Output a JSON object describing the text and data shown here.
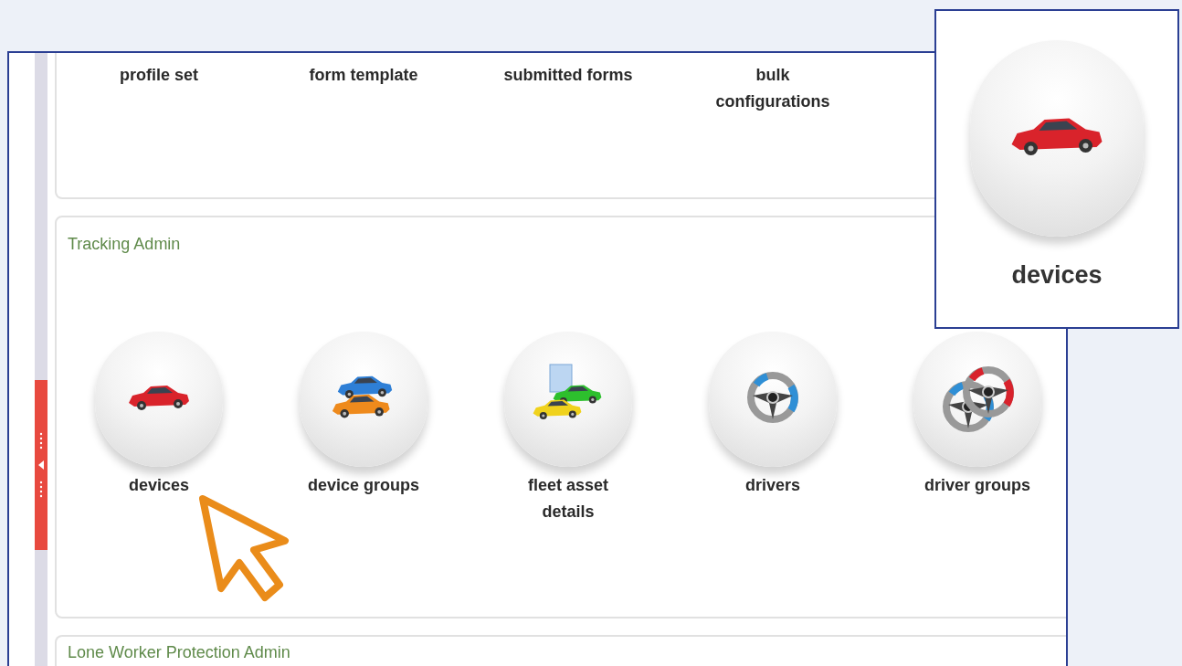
{
  "sections": [
    {
      "items": [
        {
          "label": "profile set"
        },
        {
          "label": "form template"
        },
        {
          "label": "submitted forms"
        },
        {
          "label": "bulk configurations"
        }
      ]
    },
    {
      "title": "Tracking Admin",
      "items": [
        {
          "label": "devices",
          "kind": "car"
        },
        {
          "label": "device groups",
          "kind": "cars"
        },
        {
          "label": "fleet asset details",
          "kind": "fleet"
        },
        {
          "label": "drivers",
          "kind": "wheel"
        },
        {
          "label": "driver groups",
          "kind": "wheels"
        }
      ]
    },
    {
      "title": "Lone Worker Protection Admin"
    }
  ],
  "callout": {
    "label": "devices",
    "kind": "car"
  }
}
